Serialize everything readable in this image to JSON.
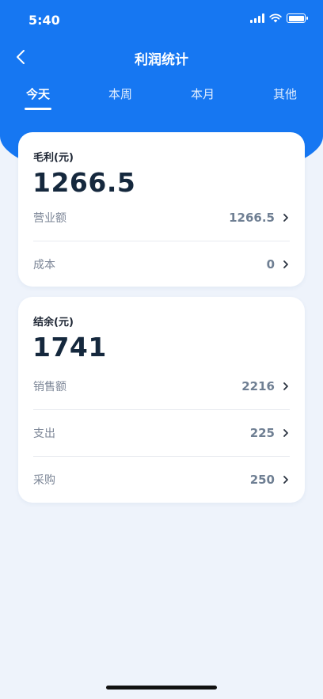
{
  "status": {
    "time": "5:40"
  },
  "header": {
    "title": "利润统计",
    "back_icon": "chevron-left-icon"
  },
  "tabs": [
    {
      "label": "今天",
      "active": true
    },
    {
      "label": "本周",
      "active": false
    },
    {
      "label": "本月",
      "active": false
    },
    {
      "label": "其他",
      "active": false
    }
  ],
  "gross_profit": {
    "label": "毛利(元)",
    "value": "1266.5",
    "rows": [
      {
        "label": "营业额",
        "value": "1266.5"
      },
      {
        "label": "成本",
        "value": "0"
      }
    ]
  },
  "balance": {
    "label": "结余(元)",
    "value": "1741",
    "rows": [
      {
        "label": "销售额",
        "value": "2216"
      },
      {
        "label": "支出",
        "value": "225"
      },
      {
        "label": "采购",
        "value": "250"
      }
    ]
  },
  "colors": {
    "primary": "#1677f2",
    "background": "#eef3fb",
    "card": "#ffffff"
  }
}
